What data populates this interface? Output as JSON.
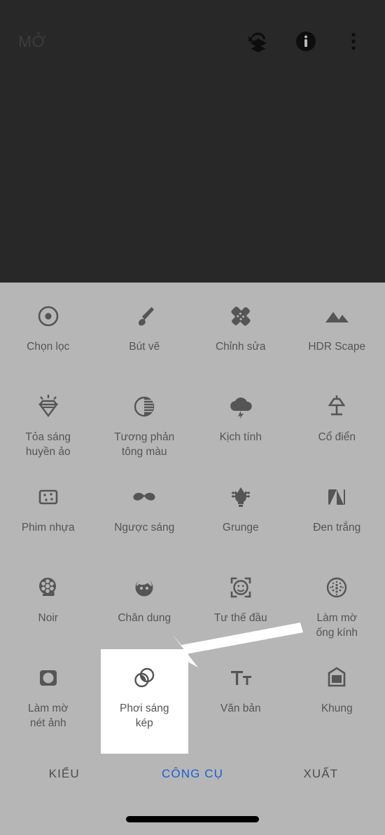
{
  "app": {
    "title": "MỞ",
    "accent_color": "#1a5fd0",
    "panel_bg": "#b6b6b6",
    "canvas_bg": "#282828",
    "icon_color": "#555555",
    "highlight_bg": "#ffffff"
  },
  "appbar": {
    "title": "MỞ",
    "actions": [
      {
        "name": "undo-layers-icon",
        "label": "Hoàn tác"
      },
      {
        "name": "info-icon",
        "label": "Thông tin"
      },
      {
        "name": "overflow-menu-icon",
        "label": "Thêm"
      }
    ]
  },
  "tools": [
    {
      "id": "chon-loc",
      "icon": "lens-blur-target-icon",
      "label": "Chọn lọc",
      "highlighted": false
    },
    {
      "id": "but-ve",
      "icon": "brush-icon",
      "label": "Bút vẽ",
      "highlighted": false
    },
    {
      "id": "chinh-sua",
      "icon": "healing-patch-icon",
      "label": "Chỉnh sửa",
      "highlighted": false
    },
    {
      "id": "hdr-scape",
      "icon": "mountains-icon",
      "label": "HDR Scape",
      "highlighted": false
    },
    {
      "id": "toa-sang",
      "icon": "diamond-glow-icon",
      "label": "Tỏa sáng\nhuyền ảo",
      "highlighted": false
    },
    {
      "id": "tuong-phan",
      "icon": "tonal-contrast-icon",
      "label": "Tương phản\ntông màu",
      "highlighted": false
    },
    {
      "id": "kich-tinh",
      "icon": "storm-cloud-icon",
      "label": "Kịch tính",
      "highlighted": false
    },
    {
      "id": "co-dien",
      "icon": "lamp-icon",
      "label": "Cổ điển",
      "highlighted": false
    },
    {
      "id": "phim-nhua",
      "icon": "film-grain-icon",
      "label": "Phim nhựa",
      "highlighted": false
    },
    {
      "id": "nguoc-sang",
      "icon": "mustache-icon",
      "label": "Ngược sáng",
      "highlighted": false
    },
    {
      "id": "grunge",
      "icon": "guitar-head-icon",
      "label": "Grunge",
      "highlighted": false
    },
    {
      "id": "den-trang",
      "icon": "black-white-icon",
      "label": "Đen trắng",
      "highlighted": false
    },
    {
      "id": "noir",
      "icon": "film-reel-icon",
      "label": "Noir",
      "highlighted": false
    },
    {
      "id": "chan-dung",
      "icon": "portrait-face-icon",
      "label": "Chân dung",
      "highlighted": false
    },
    {
      "id": "tu-the-dau",
      "icon": "head-pose-icon",
      "label": "Tư thế đầu",
      "highlighted": false
    },
    {
      "id": "lam-mo-ong-kinh",
      "icon": "lens-blur-dots-icon",
      "label": "Làm mờ\nống kính",
      "highlighted": false
    },
    {
      "id": "lam-mo-net-anh",
      "icon": "vignette-icon",
      "label": "Làm mờ\nnét ảnh",
      "highlighted": false
    },
    {
      "id": "phoi-sang-kep",
      "icon": "double-exposure-icon",
      "label": "Phơi sáng\nkép",
      "highlighted": true
    },
    {
      "id": "van-ban",
      "icon": "text-tt-icon",
      "label": "Văn bản",
      "highlighted": false
    },
    {
      "id": "khung",
      "icon": "frame-icon",
      "label": "Khung",
      "highlighted": false
    }
  ],
  "tabbar": {
    "tabs": [
      {
        "id": "kieu",
        "label": "KIỂU",
        "active": false
      },
      {
        "id": "cong-cu",
        "label": "CÔNG CỤ",
        "active": true
      },
      {
        "id": "xuat",
        "label": "XUẤT",
        "active": false
      }
    ]
  },
  "annotation": {
    "type": "arrow",
    "color": "#ffffff",
    "points_to": "phoi-sang-kep"
  }
}
